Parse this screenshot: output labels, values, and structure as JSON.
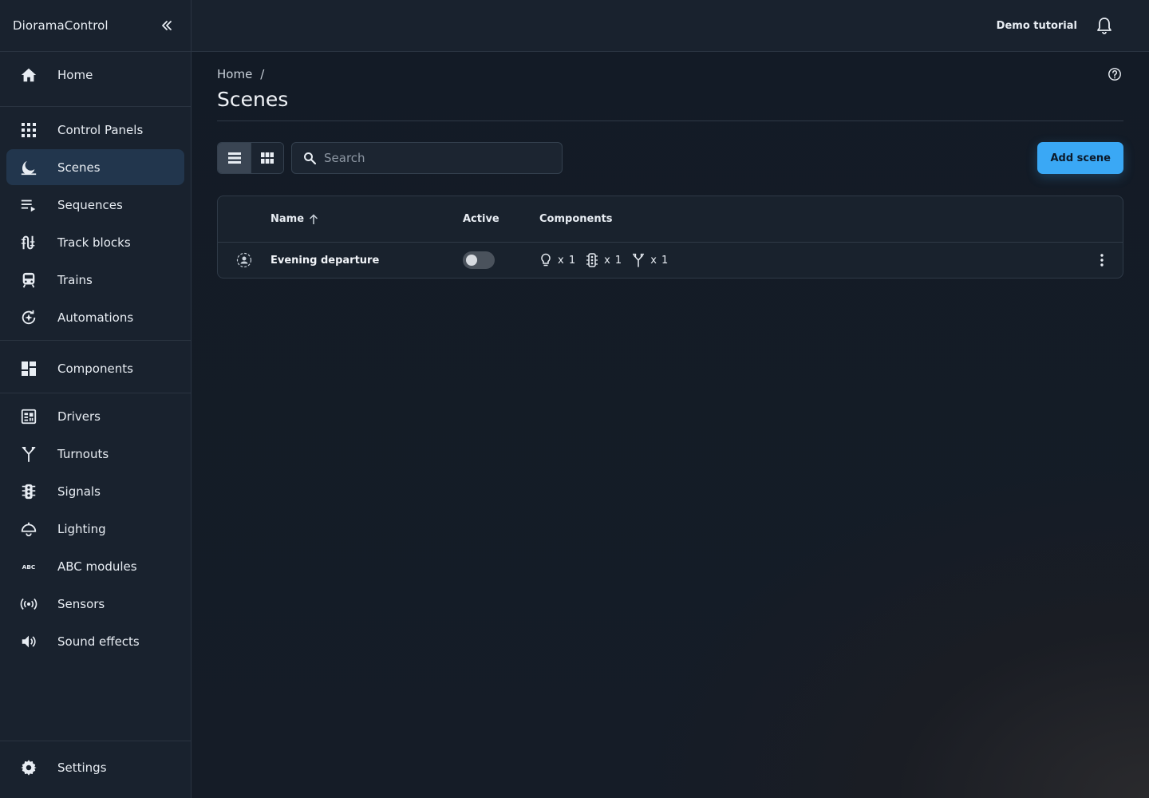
{
  "app": {
    "title": "DioramaControl"
  },
  "topbar": {
    "tutorial_label": "Demo tutorial"
  },
  "sidebar": {
    "home": {
      "label": "Home"
    },
    "group1": [
      {
        "label": "Control Panels",
        "icon": "grid-icon"
      },
      {
        "label": "Scenes",
        "icon": "scenes-icon",
        "active": true
      },
      {
        "label": "Sequences",
        "icon": "sequences-icon"
      },
      {
        "label": "Track blocks",
        "icon": "track-blocks-icon"
      },
      {
        "label": "Trains",
        "icon": "train-icon"
      },
      {
        "label": "Automations",
        "icon": "automations-icon"
      }
    ],
    "components": {
      "label": "Components"
    },
    "group2": [
      {
        "label": "Drivers",
        "icon": "drivers-icon"
      },
      {
        "label": "Turnouts",
        "icon": "turnout-icon"
      },
      {
        "label": "Signals",
        "icon": "signal-icon"
      },
      {
        "label": "Lighting",
        "icon": "lighting-icon"
      },
      {
        "label": "ABC modules",
        "icon": "abc-icon"
      },
      {
        "label": "Sensors",
        "icon": "sensor-icon"
      },
      {
        "label": "Sound effects",
        "icon": "sound-icon"
      }
    ],
    "settings": {
      "label": "Settings"
    }
  },
  "breadcrumb": {
    "home": "Home",
    "separator": "/"
  },
  "page": {
    "title": "Scenes"
  },
  "search": {
    "placeholder": "Search",
    "value": ""
  },
  "actions": {
    "add_label": "Add scene"
  },
  "table": {
    "columns": {
      "name": "Name",
      "active": "Active",
      "components": "Components"
    },
    "rows": [
      {
        "name": "Evening departure",
        "active": false,
        "components": [
          {
            "icon": "bulb-icon",
            "count": "x 1"
          },
          {
            "icon": "signal-icon",
            "count": "x 1"
          },
          {
            "icon": "turnout-icon",
            "count": "x 1"
          }
        ]
      }
    ]
  },
  "colors": {
    "accent": "#3aa8f5",
    "active_nav": "#22364d",
    "sidebar_bg": "#19222e"
  }
}
